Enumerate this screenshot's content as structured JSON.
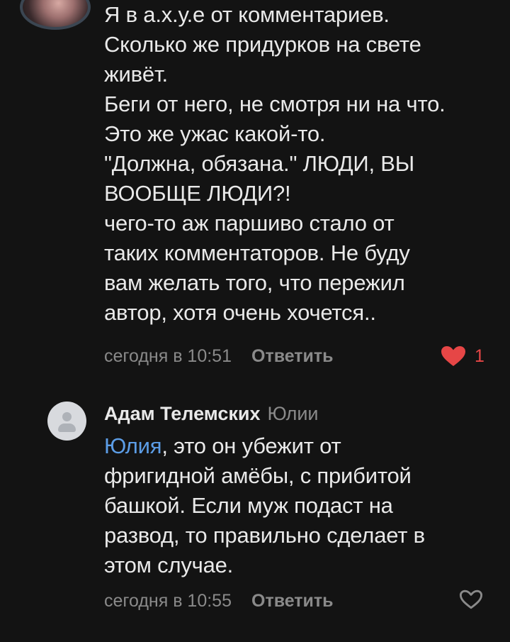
{
  "comments": [
    {
      "lines": [
        "Я в а.х.у.е от комментариев.",
        "Сколько же придурков на свете",
        "живёт.",
        "Беги от него, не смотря ни на что.",
        "Это же ужас какой-то.",
        "\"Должна, обязана.\" ЛЮДИ, ВЫ",
        "ВООБЩЕ ЛЮДИ?!",
        "чего-то аж паршиво стало от",
        "таких комментаторов. Не буду",
        "вам желать того, что пережил",
        "автор, хотя очень хочется.."
      ],
      "time": "сегодня в 10:51",
      "reply_label": "Ответить",
      "likes": "1",
      "liked": true
    },
    {
      "author": "Адам Телемских",
      "reply_to": "Юлии",
      "mention": "Юлия",
      "first_line_rest": ", это он убежит от",
      "lines": [
        "фригидной амёбы, с прибитой",
        "башкой. Если муж подаст на",
        "развод, то правильно сделает в",
        "этом случае."
      ],
      "time": "сегодня в 10:55",
      "reply_label": "Ответить",
      "liked": false
    }
  ],
  "icons": {
    "liked": "heart-filled-icon",
    "not_liked": "heart-outline-icon",
    "default_avatar": "user-icon"
  },
  "colors": {
    "background": "#131313",
    "text": "#e9e9e9",
    "meta": "#8a8a8a",
    "mention": "#5c9de6",
    "like": "#e64646"
  }
}
